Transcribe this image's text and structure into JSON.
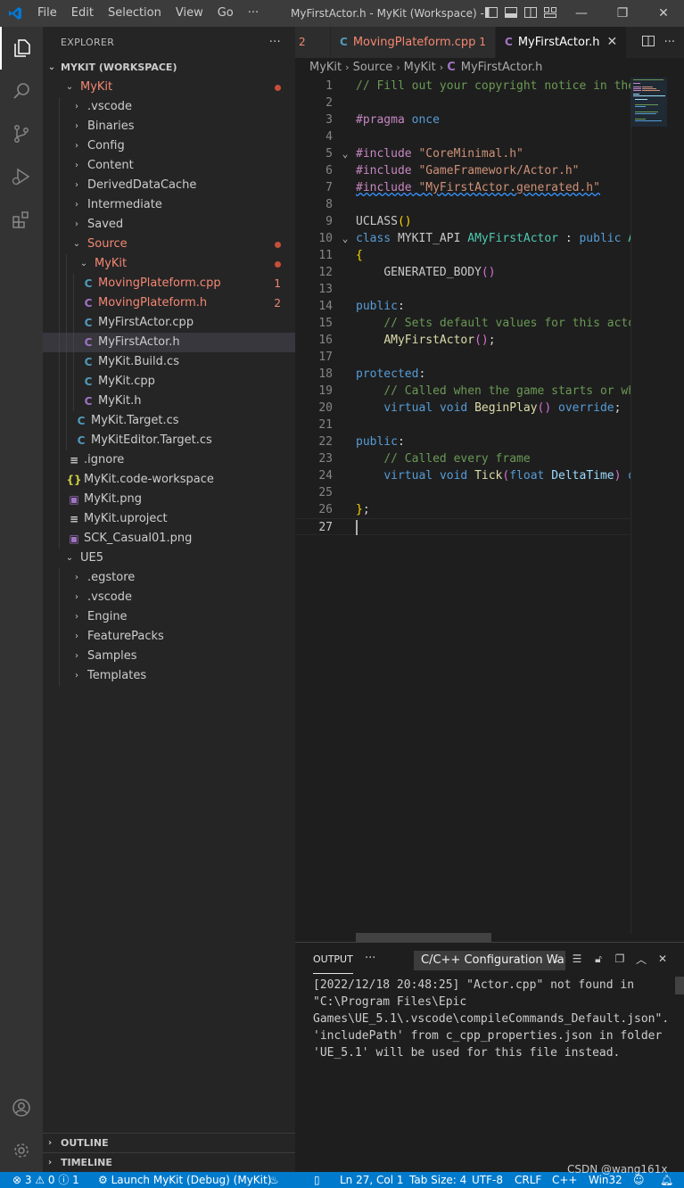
{
  "titlebar": {
    "menu": [
      "File",
      "Edit",
      "Selection",
      "View",
      "Go"
    ],
    "more": "···",
    "window_title": "MyFirstActor.h - MyKit (Workspace) - Visual Studio Code",
    "minimize": "—",
    "restore": "❐",
    "close": "✕"
  },
  "sidebar": {
    "title": "EXPLORER",
    "more": "···",
    "workspace": "MYKIT (WORKSPACE)",
    "tree": [
      {
        "label": "MyKit",
        "depth": 0,
        "type": "folder-open",
        "error": true,
        "dot": true
      },
      {
        "label": ".vscode",
        "depth": 1,
        "type": "folder"
      },
      {
        "label": "Binaries",
        "depth": 1,
        "type": "folder"
      },
      {
        "label": "Config",
        "depth": 1,
        "type": "folder"
      },
      {
        "label": "Content",
        "depth": 1,
        "type": "folder"
      },
      {
        "label": "DerivedDataCache",
        "depth": 1,
        "type": "folder"
      },
      {
        "label": "Intermediate",
        "depth": 1,
        "type": "folder"
      },
      {
        "label": "Saved",
        "depth": 1,
        "type": "folder"
      },
      {
        "label": "Source",
        "depth": 1,
        "type": "folder-open",
        "error": true,
        "dot": true
      },
      {
        "label": "MyKit",
        "depth": 2,
        "type": "folder-open",
        "error": true,
        "dot": true
      },
      {
        "label": "MovingPlateform.cpp",
        "depth": 3,
        "type": "cpp",
        "error": true,
        "count": "1"
      },
      {
        "label": "MovingPlateform.h",
        "depth": 3,
        "type": "h",
        "error": true,
        "count": "2"
      },
      {
        "label": "MyFirstActor.cpp",
        "depth": 3,
        "type": "cpp"
      },
      {
        "label": "MyFirstActor.h",
        "depth": 3,
        "type": "h",
        "selected": true
      },
      {
        "label": "MyKit.Build.cs",
        "depth": 3,
        "type": "cs"
      },
      {
        "label": "MyKit.cpp",
        "depth": 3,
        "type": "cpp"
      },
      {
        "label": "MyKit.h",
        "depth": 3,
        "type": "h"
      },
      {
        "label": "MyKit.Target.cs",
        "depth": 2,
        "type": "cs"
      },
      {
        "label": "MyKitEditor.Target.cs",
        "depth": 2,
        "type": "cs"
      },
      {
        "label": ".ignore",
        "depth": 1,
        "type": "text"
      },
      {
        "label": "MyKit.code-workspace",
        "depth": 1,
        "type": "json"
      },
      {
        "label": "MyKit.png",
        "depth": 1,
        "type": "image"
      },
      {
        "label": "MyKit.uproject",
        "depth": 1,
        "type": "text"
      },
      {
        "label": "SCK_Casual01.png",
        "depth": 1,
        "type": "image"
      },
      {
        "label": "UE5",
        "depth": 0,
        "type": "folder-open"
      },
      {
        "label": ".egstore",
        "depth": 1,
        "type": "folder"
      },
      {
        "label": ".vscode",
        "depth": 1,
        "type": "folder"
      },
      {
        "label": "Engine",
        "depth": 1,
        "type": "folder"
      },
      {
        "label": "FeaturePacks",
        "depth": 1,
        "type": "folder"
      },
      {
        "label": "Samples",
        "depth": 1,
        "type": "folder"
      },
      {
        "label": "Templates",
        "depth": 1,
        "type": "folder"
      }
    ],
    "outline": "OUTLINE",
    "timeline": "TIMELINE"
  },
  "editor": {
    "tabs": [
      {
        "label": "",
        "count": "2",
        "icon": "",
        "active": false,
        "error": true
      },
      {
        "label": "MovingPlateform.cpp",
        "count": "1",
        "icon": "C",
        "active": false,
        "error": true
      },
      {
        "label": "MyFirstActor.h",
        "count": "",
        "icon": "C",
        "active": true,
        "error": false
      }
    ],
    "breadcrumb": [
      "MyKit",
      "Source",
      "MyKit",
      "MyFirstActor.h"
    ],
    "lines": [
      {
        "n": "1",
        "html": "<span class=\"cm\">// Fill out your copyright notice in the Description page of Project Settings.</span>"
      },
      {
        "n": "2",
        "html": ""
      },
      {
        "n": "3",
        "html": "<span class=\"pp\">#pragma</span> <span class=\"kw\">once</span>"
      },
      {
        "n": "4",
        "html": ""
      },
      {
        "n": "5",
        "html": "<span class=\"pp\">#include</span> <span class=\"str\">\"CoreMinimal.h\"</span>",
        "fold": true
      },
      {
        "n": "6",
        "html": "<span class=\"pp\">#include</span> <span class=\"str\">\"GameFramework/Actor.h\"</span>"
      },
      {
        "n": "7",
        "html": "<span class=\"squiggle\"><span class=\"pp\">#include</span> <span class=\"str\">\"MyFirstActor.generated.h\"</span></span>"
      },
      {
        "n": "8",
        "html": ""
      },
      {
        "n": "9",
        "html": "<span class=\"mac\">UCLASS</span><span class=\"br1\">()</span>"
      },
      {
        "n": "10",
        "html": "<span class=\"kw\">class</span> <span class=\"mac\">MYKIT_API</span> <span class=\"ty\">AMyFirstActor</span> : <span class=\"kw\">public</span> <span class=\"ty\">AActor</span>",
        "fold": true
      },
      {
        "n": "11",
        "html": "<span class=\"br1\">{</span>"
      },
      {
        "n": "12",
        "html": "    <span class=\"mac\">GENERATED_BODY</span><span class=\"br2\">()</span>"
      },
      {
        "n": "13",
        "html": ""
      },
      {
        "n": "14",
        "html": "<span class=\"kw\">public</span>:"
      },
      {
        "n": "15",
        "html": "    <span class=\"cm\">// Sets default values for this actor's properties</span>"
      },
      {
        "n": "16",
        "html": "    <span class=\"fn\">AMyFirstActor</span><span class=\"br2\">()</span>;"
      },
      {
        "n": "17",
        "html": ""
      },
      {
        "n": "18",
        "html": "<span class=\"kw\">protected</span>:"
      },
      {
        "n": "19",
        "html": "    <span class=\"cm\">// Called when the game starts or when spawned</span>"
      },
      {
        "n": "20",
        "html": "    <span class=\"kw\">virtual</span> <span class=\"kw\">void</span> <span class=\"fn\">BeginPlay</span><span class=\"br2\">()</span> <span class=\"kw\">override</span>;"
      },
      {
        "n": "21",
        "html": ""
      },
      {
        "n": "22",
        "html": "<span class=\"kw\">public</span>:"
      },
      {
        "n": "23",
        "html": "    <span class=\"cm\">// Called every frame</span>"
      },
      {
        "n": "24",
        "html": "    <span class=\"kw\">virtual</span> <span class=\"kw\">void</span> <span class=\"fn\">Tick</span><span class=\"br2\">(</span><span class=\"kw\">float</span> <span class=\"id\">DeltaTime</span><span class=\"br2\">)</span> <span class=\"kw\">override</span>;"
      },
      {
        "n": "25",
        "html": ""
      },
      {
        "n": "26",
        "html": "<span class=\"br1\">}</span>;"
      },
      {
        "n": "27",
        "html": "",
        "cursor": true
      }
    ]
  },
  "panel": {
    "tab": "OUTPUT",
    "more": "···",
    "channel": "C/C++ Configuration Warnings",
    "output": "[2022/12/18 20:48:25] \"Actor.cpp\" not found in \"C:\\Program Files\\Epic Games\\UE_5.1\\.vscode\\compileCommands_Default.json\". 'includePath' from c_cpp_properties.json in folder 'UE_5.1' will be used for this file instead."
  },
  "statusbar": {
    "problems": "⊗ 3 ⚠ 0 ⓘ 1",
    "launch": "Launch MyKit (Debug) (MyKit)",
    "position": "Ln 27, Col 1",
    "tabsize": "Tab Size: 4",
    "encoding": "UTF-8",
    "eol": "CRLF",
    "language": "C++",
    "platform": "Win32"
  },
  "watermark": "CSDN @wang161x",
  "colors": {
    "accent": "#007acc",
    "error": "#f48771",
    "selected": "#37373d"
  }
}
